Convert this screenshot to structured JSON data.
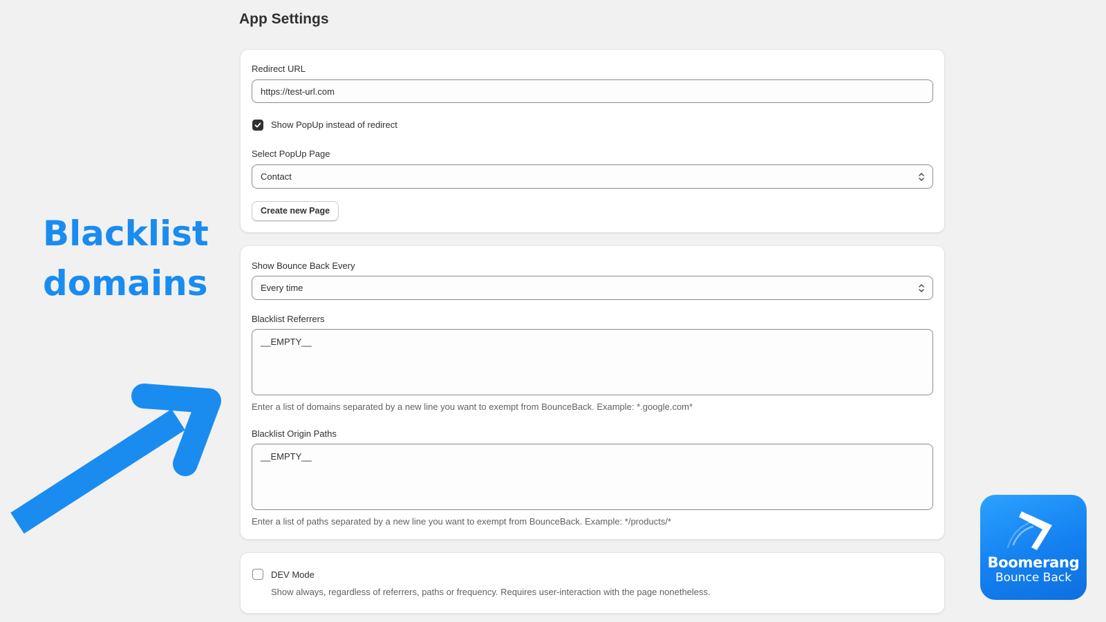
{
  "page": {
    "title": "App Settings"
  },
  "redirect_card": {
    "redirect_url_label": "Redirect URL",
    "redirect_url_value": "https://test-url.com",
    "show_popup_label": "Show PopUp instead of redirect",
    "show_popup_checked": true,
    "select_popup_label": "Select PopUp Page",
    "select_popup_value": "Contact",
    "create_page_button": "Create new Page"
  },
  "bounce_card": {
    "frequency_label": "Show Bounce Back Every",
    "frequency_value": "Every time",
    "referrers_label": "Blacklist Referrers",
    "referrers_value": "__EMPTY__",
    "referrers_help": "Enter a list of domains separated by a new line you want to exempt from BounceBack. Example: *.google.com*",
    "paths_label": "Blacklist Origin Paths",
    "paths_value": "__EMPTY__",
    "paths_help": "Enter a list of paths separated by a new line you want to exempt from BounceBack. Example: */products/*"
  },
  "dev_card": {
    "dev_mode_label": "DEV Mode",
    "dev_mode_checked": false,
    "dev_mode_help": "Show always, regardless of referrers, paths or frequency. Requires user-interaction with the page nonetheless."
  },
  "promo": {
    "heading_line1": "Blacklist",
    "heading_line2": "domains",
    "arrow_icon": "arrow-up-right-icon",
    "accent_color": "#1a8cf0"
  },
  "logo": {
    "name": "Boomerang",
    "subtitle": "Bounce Back",
    "icon": "boomerang-icon",
    "color": "#1a8cf0"
  }
}
